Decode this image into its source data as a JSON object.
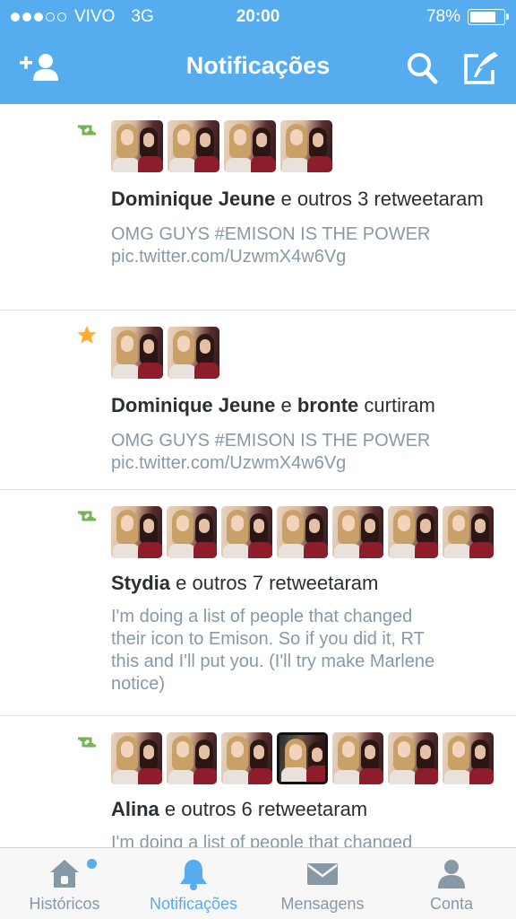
{
  "status_bar": {
    "carrier": "VIVO",
    "network": "3G",
    "time": "20:00",
    "battery_percent": "78%",
    "battery_level": 0.78,
    "signal_bars_filled": 3,
    "signal_bars_total": 5
  },
  "nav": {
    "title": "Notificações",
    "left_icon": "add-user-icon",
    "right_icons": [
      "search-icon",
      "compose-icon"
    ]
  },
  "colors": {
    "brand": "#55acee",
    "retweet": "#77b255",
    "star": "#ffac33",
    "text_secondary": "#8899a6"
  },
  "notifications": [
    {
      "icon": "retweet-icon",
      "avatar_count": 4,
      "actor": "Dominique Jeune",
      "rest": " e outros 3 retweetaram",
      "tweet_line1": "OMG GUYS #EMISON IS THE POWER",
      "tweet_line2": "pic.twitter.com/UzwmX4w6Vg"
    },
    {
      "icon": "star-icon",
      "avatar_count": 2,
      "actor": "Dominique Jeune",
      "connector": " e ",
      "actor2": "bronte",
      "rest": " curtiram",
      "tweet_line1": "OMG GUYS #EMISON IS THE POWER",
      "tweet_line2": "pic.twitter.com/UzwmX4w6Vg"
    },
    {
      "icon": "retweet-icon",
      "avatar_count": 7,
      "actor": "Stydia",
      "rest": " e outros 7 retweetaram",
      "tweet_line1": "I'm doing a list of people that changed",
      "tweet_line2": "their icon to Emison. So if you did it, RT",
      "tweet_line3": "this and I'll put you. (I'll try make Marlene",
      "tweet_line4": "notice)"
    },
    {
      "icon": "retweet-icon",
      "avatar_count": 7,
      "actor": "Alina",
      "rest": " e outros 6 retweetaram",
      "tweet_line1": "I'm doing a list of people that changed"
    }
  ],
  "tabs": [
    {
      "label": "Históricos",
      "icon": "home-icon"
    },
    {
      "label": "Notificações",
      "icon": "bell-icon",
      "active": true
    },
    {
      "label": "Mensagens",
      "icon": "envelope-icon"
    },
    {
      "label": "Conta",
      "icon": "person-icon"
    }
  ]
}
